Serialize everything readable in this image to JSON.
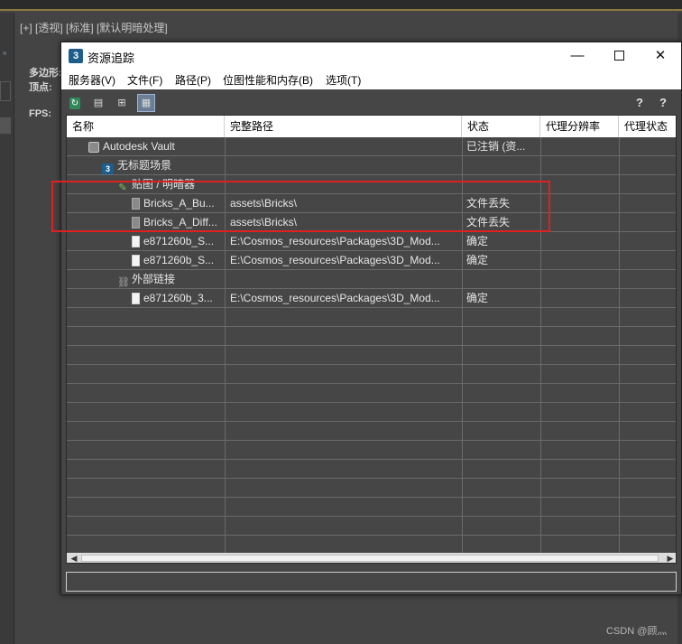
{
  "background": {
    "viewport_label": "[+] [透视] [标准] [默认明暗处理]",
    "stats": {
      "polygons_label": "多边形:",
      "vertices_label": "顶点:",
      "fps_label": "FPS:"
    },
    "watermark": "CSDN @顾灬"
  },
  "window": {
    "title": "资源追踪",
    "app_icon": "3"
  },
  "menu": [
    "服务器(V)",
    "文件(F)",
    "路径(P)",
    "位图性能和内存(B)",
    "选项(T)"
  ],
  "toolbar": {
    "buttons": [
      {
        "name": "refresh-icon"
      },
      {
        "name": "list-view-icon"
      },
      {
        "name": "tree-view-icon"
      },
      {
        "name": "table-view-icon",
        "active": true
      }
    ],
    "help": [
      "?",
      "?"
    ]
  },
  "table": {
    "columns": [
      "名称",
      "完整路径",
      "状态",
      "代理分辨率",
      "代理状态"
    ],
    "rows": [
      {
        "icon": "vault",
        "name": "Autodesk Vault",
        "path": "",
        "status": "已注销 (资..."
      },
      {
        "icon": "scene",
        "name": "无标题场景",
        "path": "",
        "status": ""
      },
      {
        "icon": "maps",
        "name": "贴图 / 明暗器",
        "path": "",
        "status": ""
      },
      {
        "icon": "file-missing",
        "name": "Bricks_A_Bu...",
        "path": "assets\\Bricks\\",
        "status": "文件丢失"
      },
      {
        "icon": "file-missing",
        "name": "Bricks_A_Diff...",
        "path": "assets\\Bricks\\",
        "status": "文件丢失"
      },
      {
        "icon": "file",
        "name": "e871260b_S...",
        "path": "E:\\Cosmos_resources\\Packages\\3D_Mod...",
        "status": "确定"
      },
      {
        "icon": "file",
        "name": "e871260b_S...",
        "path": "E:\\Cosmos_resources\\Packages\\3D_Mod...",
        "status": "确定"
      },
      {
        "icon": "link",
        "name": "外部链接",
        "path": "",
        "status": ""
      },
      {
        "icon": "file",
        "name": "e871260b_3...",
        "path": "E:\\Cosmos_resources\\Packages\\3D_Mod...",
        "status": "确定"
      }
    ],
    "empty_rows": 13
  }
}
